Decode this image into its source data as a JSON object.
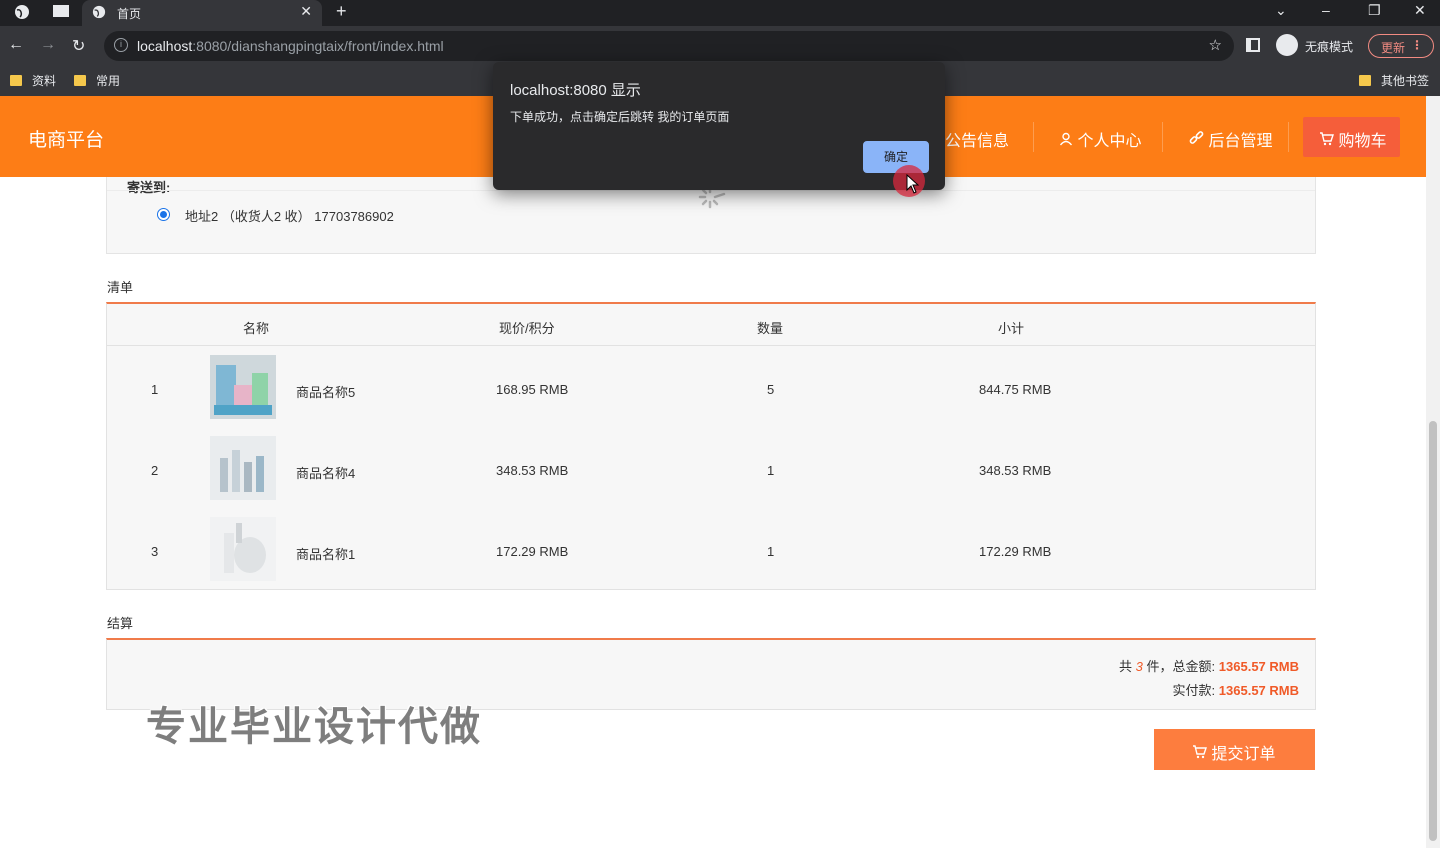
{
  "browser": {
    "tab_title": "首页",
    "url_host": "localhost",
    "url_rest": ":8080/dianshangpingtaix/front/index.html",
    "incognito_label": "无痕模式",
    "update_label": "更新",
    "bookmarks": [
      "资料",
      "常用"
    ],
    "other_bookmarks": "其他书签"
  },
  "header": {
    "brand": "电商平台",
    "nav": [
      "公告信息",
      "个人中心",
      "后台管理"
    ],
    "cart": "购物车"
  },
  "address": {
    "title": "寄送到:",
    "line": "地址2 （收货人2 收） 17703786902"
  },
  "list": {
    "label": "清单",
    "columns": [
      "名称",
      "现价/积分",
      "数量",
      "小计"
    ],
    "rows": [
      {
        "index": "1",
        "name": "商品名称5",
        "price": "168.95 RMB",
        "qty": "5",
        "subtotal": "844.75 RMB"
      },
      {
        "index": "2",
        "name": "商品名称4",
        "price": "348.53 RMB",
        "qty": "1",
        "subtotal": "348.53 RMB"
      },
      {
        "index": "3",
        "name": "商品名称1",
        "price": "172.29 RMB",
        "qty": "1",
        "subtotal": "172.29 RMB"
      }
    ]
  },
  "settlement": {
    "label": "结算",
    "count_prefix": "共",
    "count": "3",
    "count_suffix": "件，总金额:",
    "total": "1365.57 RMB",
    "paid_label": "实付款:",
    "paid": "1365.57 RMB"
  },
  "submit_label": "提交订单",
  "watermark": "专业毕业设计代做",
  "dialog": {
    "title": "localhost:8080 显示",
    "message": "下单成功，点击确定后跳转 我的订单页面",
    "ok": "确定"
  },
  "colors": {
    "header": "#fd7d16",
    "cart_button": "#f55e3a",
    "accent_red": "#f05a28",
    "submit": "#fd7d3e"
  }
}
